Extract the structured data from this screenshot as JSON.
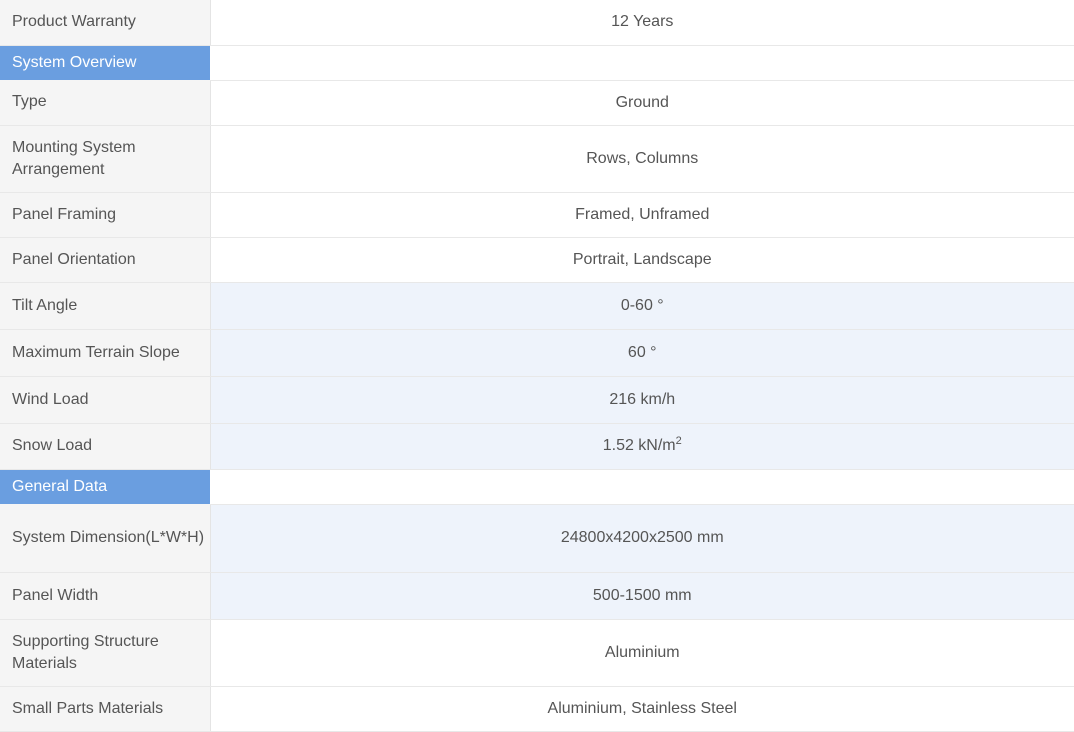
{
  "rows": [
    {
      "kind": "data",
      "label": "Product Warranty",
      "value": "12 Years",
      "shaded": false
    },
    {
      "kind": "section",
      "label": "System Overview"
    },
    {
      "kind": "data",
      "label": "Type",
      "value": "Ground",
      "shaded": false
    },
    {
      "kind": "data",
      "label": "Mounting System Arrangement",
      "value": "Rows, Columns",
      "shaded": false
    },
    {
      "kind": "data",
      "label": "Panel Framing",
      "value": "Framed, Unframed",
      "shaded": false
    },
    {
      "kind": "data",
      "label": "Panel Orientation",
      "value": "Portrait, Landscape",
      "shaded": false
    },
    {
      "kind": "data",
      "label": "Tilt Angle",
      "value": "0-60 °",
      "shaded": true
    },
    {
      "kind": "data",
      "label": "Maximum Terrain Slope",
      "value": "60 °",
      "shaded": true
    },
    {
      "kind": "data",
      "label": "Wind Load",
      "value": "216 km/h",
      "shaded": true
    },
    {
      "kind": "data",
      "label": "Snow Load",
      "value": "1.52 kN/m",
      "sup": "2",
      "shaded": true
    },
    {
      "kind": "section",
      "label": "General Data"
    },
    {
      "kind": "data",
      "label": "System Dimension(L*W*H)",
      "value": "24800x4200x2500 mm",
      "shaded": true
    },
    {
      "kind": "data",
      "label": "Panel Width",
      "value": "500-1500 mm",
      "shaded": true
    },
    {
      "kind": "data",
      "label": "Supporting Structure Materials",
      "value": "Aluminium",
      "shaded": false
    },
    {
      "kind": "data",
      "label": "Small Parts Materials",
      "value": "Aluminium, Stainless Steel",
      "shaded": false
    }
  ]
}
